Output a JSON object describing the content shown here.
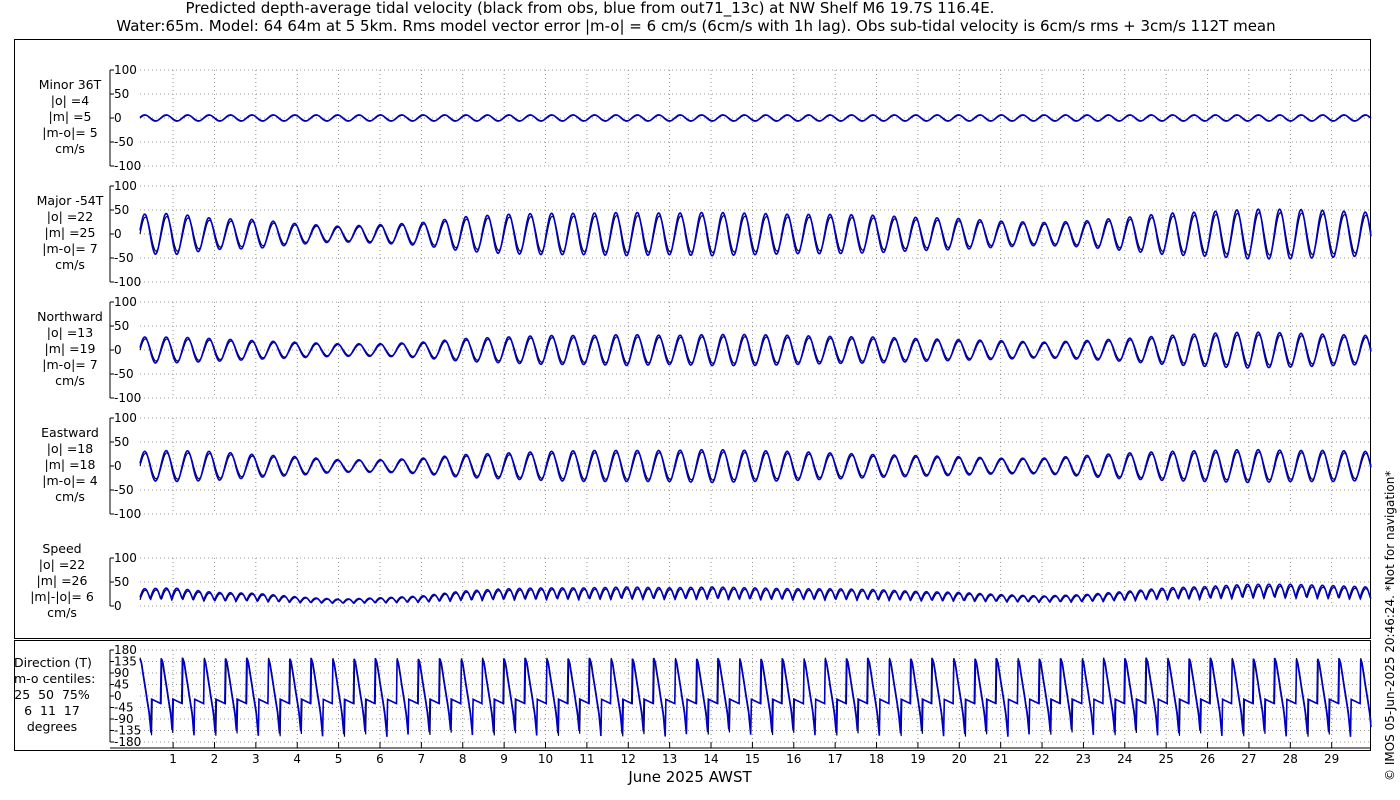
{
  "title_line1": "Predicted depth-average tidal velocity (black from obs, blue from out71_13c) at NW Shelf M6 19.7S 116.4E.",
  "title_line2": "Water:65m. Model: 64 64m at 5 5km. Rms model vector error |m-o| = 6 cm/s (6cm/s with 1h lag). Obs sub-tidal velocity is 6cm/s rms + 3cm/s 112T mean",
  "xlabel": "June 2025 AWST",
  "copyright": "© IMOS 05-Jun-2025 20:46:24. *Not for navigation*",
  "colors": {
    "obs": "#000000",
    "model": "#0000c8",
    "grid": "#7a7a7a"
  },
  "panels": [
    {
      "label": "Minor 36T\n|o| =4\n|m| =5\n|m-o|= 5\ncm/s",
      "yticks": [
        "100",
        "50",
        "0",
        "-50",
        "-100"
      ]
    },
    {
      "label": "Major -54T\n|o| =22\n|m| =25\n|m-o|= 7\ncm/s",
      "yticks": [
        "100",
        "50",
        "0",
        "-50",
        "-100"
      ]
    },
    {
      "label": "Northward\n|o| =13\n|m| =19\n|m-o|= 7\ncm/s",
      "yticks": [
        "100",
        "50",
        "0",
        "-50",
        "-100"
      ]
    },
    {
      "label": "Eastward\n|o| =18\n|m| =18\n|m-o|= 4\ncm/s",
      "yticks": [
        "100",
        "50",
        "0",
        "-50",
        "-100"
      ]
    },
    {
      "label": "Speed\n|o| =22\n|m| =26\n|m|-|o|= 6\ncm/s",
      "yticks": [
        "100",
        "50",
        "0"
      ]
    },
    {
      "label": "Direction (T)\nm-o centiles:\n25  50  75%\n6  11  17\ndegrees",
      "yticks": [
        "180",
        "135",
        "90",
        "45",
        "0",
        "-45",
        "-90",
        "-135",
        "-180"
      ]
    }
  ],
  "xticks": [
    "1",
    "2",
    "3",
    "4",
    "5",
    "6",
    "7",
    "8",
    "9",
    "10",
    "11",
    "12",
    "13",
    "14",
    "15",
    "16",
    "17",
    "18",
    "19",
    "20",
    "21",
    "22",
    "23",
    "24",
    "25",
    "26",
    "27",
    "28",
    "29"
  ],
  "chart_data": {
    "type": "line",
    "x_unit": "day of June 2025 (AWST)",
    "x_range": [
      0.2,
      29.95
    ],
    "series": [
      {
        "name": "black from obs"
      },
      {
        "name": "blue from out71_13c"
      }
    ],
    "tidal_period_hours": 12.42,
    "panels": [
      {
        "name": "Minor 36T",
        "ylim": [
          -100,
          100
        ],
        "amplitude_envelope_cm_s": [
          [
            0.2,
            6
          ],
          [
            29.9,
            6
          ]
        ]
      },
      {
        "name": "Major -54T",
        "ylim": [
          -100,
          100
        ],
        "amplitude_envelope_cm_s": [
          [
            0.2,
            38
          ],
          [
            1,
            40
          ],
          [
            2,
            30
          ],
          [
            3,
            28
          ],
          [
            4,
            20
          ],
          [
            5,
            15
          ],
          [
            6,
            18
          ],
          [
            7,
            22
          ],
          [
            8,
            33
          ],
          [
            9,
            38
          ],
          [
            10,
            40
          ],
          [
            11,
            40
          ],
          [
            12,
            42
          ],
          [
            13,
            40
          ],
          [
            14,
            42
          ],
          [
            15,
            40
          ],
          [
            16,
            38
          ],
          [
            17,
            38
          ],
          [
            18,
            36
          ],
          [
            19,
            32
          ],
          [
            20,
            30
          ],
          [
            21,
            25
          ],
          [
            22,
            22
          ],
          [
            23,
            25
          ],
          [
            24,
            32
          ],
          [
            25,
            40
          ],
          [
            26,
            43
          ],
          [
            27,
            48
          ],
          [
            28,
            48
          ],
          [
            29,
            45
          ],
          [
            29.9,
            42
          ]
        ]
      },
      {
        "name": "Northward",
        "ylim": [
          -100,
          100
        ],
        "amplitude_envelope_cm_s": [
          [
            0.2,
            25
          ],
          [
            1,
            25
          ],
          [
            2,
            22
          ],
          [
            3,
            18
          ],
          [
            4,
            15
          ],
          [
            5,
            12
          ],
          [
            6,
            12
          ],
          [
            7,
            15
          ],
          [
            8,
            22
          ],
          [
            9,
            25
          ],
          [
            10,
            28
          ],
          [
            11,
            28
          ],
          [
            12,
            30
          ],
          [
            13,
            28
          ],
          [
            14,
            30
          ],
          [
            15,
            30
          ],
          [
            16,
            28
          ],
          [
            17,
            26
          ],
          [
            18,
            25
          ],
          [
            19,
            22
          ],
          [
            20,
            20
          ],
          [
            21,
            18
          ],
          [
            22,
            15
          ],
          [
            23,
            18
          ],
          [
            24,
            22
          ],
          [
            25,
            28
          ],
          [
            26,
            32
          ],
          [
            27,
            35
          ],
          [
            28,
            33
          ],
          [
            29,
            30
          ],
          [
            29.9,
            28
          ]
        ]
      },
      {
        "name": "Eastward",
        "ylim": [
          -100,
          100
        ],
        "amplitude_envelope_cm_s": [
          [
            0.2,
            28
          ],
          [
            1,
            30
          ],
          [
            2,
            28
          ],
          [
            3,
            22
          ],
          [
            4,
            18
          ],
          [
            5,
            12
          ],
          [
            6,
            12
          ],
          [
            7,
            15
          ],
          [
            8,
            22
          ],
          [
            9,
            25
          ],
          [
            10,
            28
          ],
          [
            11,
            30
          ],
          [
            12,
            30
          ],
          [
            13,
            30
          ],
          [
            14,
            32
          ],
          [
            15,
            30
          ],
          [
            16,
            28
          ],
          [
            17,
            25
          ],
          [
            18,
            22
          ],
          [
            19,
            20
          ],
          [
            20,
            18
          ],
          [
            21,
            15
          ],
          [
            22,
            15
          ],
          [
            23,
            20
          ],
          [
            24,
            25
          ],
          [
            25,
            28
          ],
          [
            26,
            30
          ],
          [
            27,
            32
          ],
          [
            28,
            30
          ],
          [
            29,
            30
          ],
          [
            29.9,
            28
          ]
        ]
      },
      {
        "name": "Speed",
        "ylim": [
          0,
          100
        ],
        "amplitude_envelope_cm_s": [
          [
            0.2,
            38
          ],
          [
            1,
            40
          ],
          [
            2,
            30
          ],
          [
            3,
            28
          ],
          [
            4,
            20
          ],
          [
            5,
            15
          ],
          [
            6,
            18
          ],
          [
            7,
            22
          ],
          [
            8,
            33
          ],
          [
            9,
            38
          ],
          [
            10,
            40
          ],
          [
            11,
            40
          ],
          [
            12,
            42
          ],
          [
            13,
            40
          ],
          [
            14,
            42
          ],
          [
            15,
            40
          ],
          [
            16,
            38
          ],
          [
            17,
            38
          ],
          [
            18,
            36
          ],
          [
            19,
            32
          ],
          [
            20,
            30
          ],
          [
            21,
            25
          ],
          [
            22,
            22
          ],
          [
            23,
            25
          ],
          [
            24,
            32
          ],
          [
            25,
            40
          ],
          [
            26,
            43
          ],
          [
            27,
            48
          ],
          [
            28,
            48
          ],
          [
            29,
            45
          ],
          [
            29.9,
            42
          ]
        ]
      },
      {
        "name": "Direction (T)",
        "ylim": [
          -180,
          180
        ],
        "units": "degrees",
        "range_deg": [
          -180,
          180
        ]
      }
    ]
  }
}
